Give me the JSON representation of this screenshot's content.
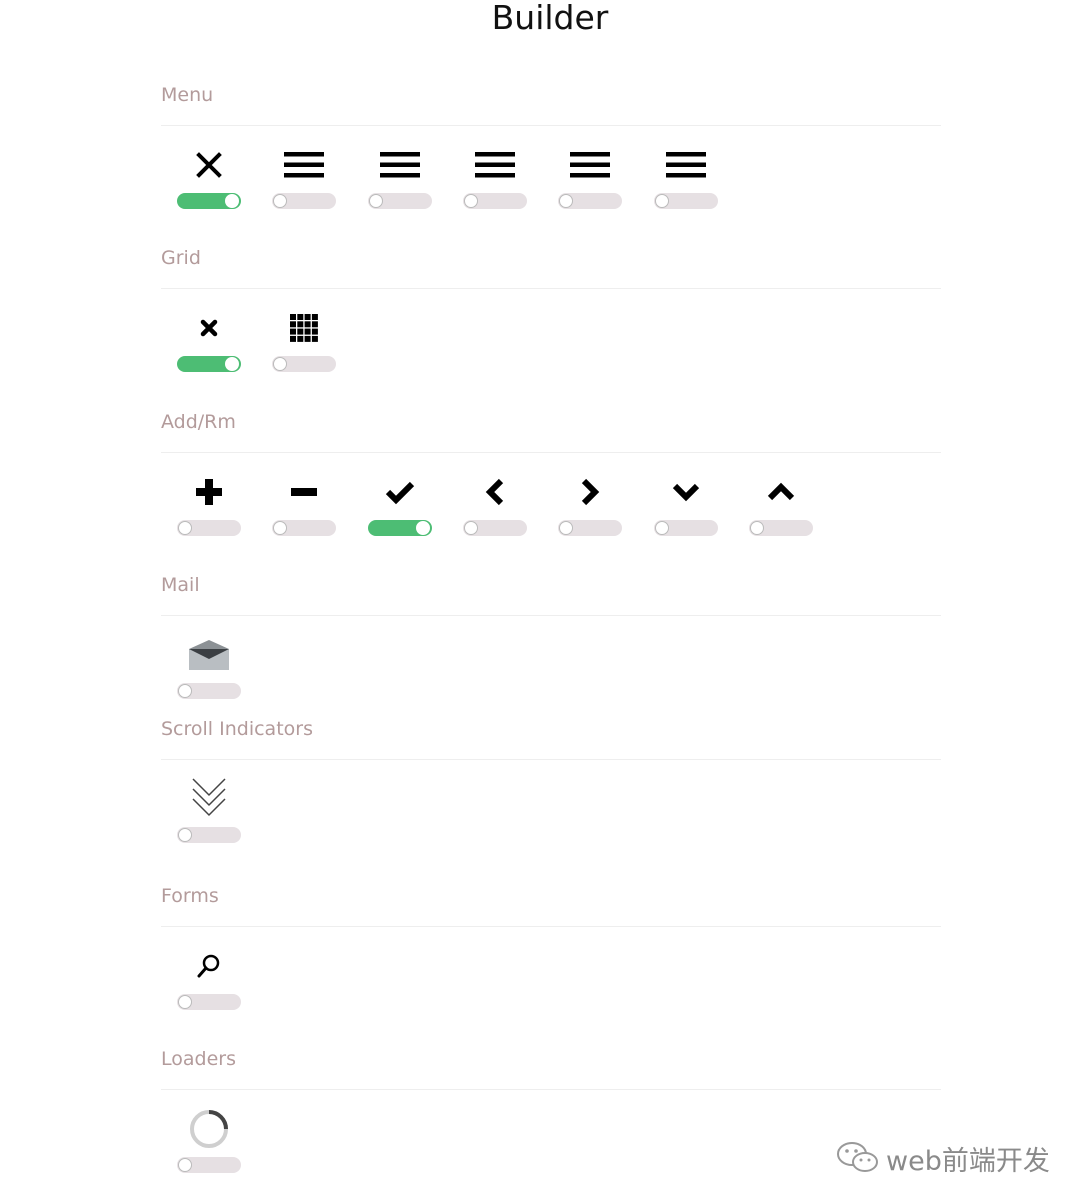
{
  "page": {
    "title": "Builder"
  },
  "sections": [
    {
      "label": "Menu",
      "items": [
        {
          "icon": "close-icon",
          "on": true
        },
        {
          "icon": "hamburger-icon",
          "on": false
        },
        {
          "icon": "hamburger-icon",
          "on": false
        },
        {
          "icon": "hamburger-icon",
          "on": false
        },
        {
          "icon": "hamburger-icon",
          "on": false
        },
        {
          "icon": "hamburger-icon",
          "on": false
        }
      ]
    },
    {
      "label": "Grid",
      "items": [
        {
          "icon": "close-small-icon",
          "on": true
        },
        {
          "icon": "grid-icon",
          "on": false
        }
      ]
    },
    {
      "label": "Add/Rm",
      "items": [
        {
          "icon": "plus-icon",
          "on": false
        },
        {
          "icon": "minus-icon",
          "on": false
        },
        {
          "icon": "check-icon",
          "on": true
        },
        {
          "icon": "chevron-left-icon",
          "on": false
        },
        {
          "icon": "chevron-right-icon",
          "on": false
        },
        {
          "icon": "chevron-down-icon",
          "on": false
        },
        {
          "icon": "chevron-up-icon",
          "on": false
        }
      ]
    },
    {
      "label": "Mail",
      "items": [
        {
          "icon": "mail-icon",
          "on": false
        }
      ]
    },
    {
      "label": "Scroll Indicators",
      "items": [
        {
          "icon": "scroll-down-icon",
          "on": false
        }
      ]
    },
    {
      "label": "Forms",
      "items": [
        {
          "icon": "search-icon",
          "on": false
        }
      ]
    },
    {
      "label": "Loaders",
      "items": [
        {
          "icon": "spinner-icon",
          "on": false
        }
      ]
    }
  ],
  "colors": {
    "toggle_on": "#4dbd74",
    "toggle_off": "#e6e0e3",
    "label": "#b39b9b"
  },
  "watermark": {
    "text": "web前端开发",
    "icon": "wechat-icon"
  }
}
